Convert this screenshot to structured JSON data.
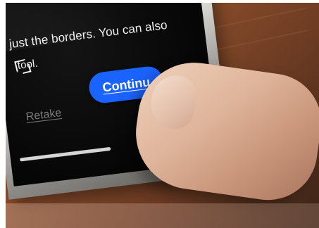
{
  "screen": {
    "instructions_line1": "just the borders. You can also",
    "instructions_line2": "tool.",
    "retake_label": "Retake",
    "continue_label": "Continu"
  },
  "icons": {
    "crop": "crop-icon"
  },
  "colors": {
    "continue_button": "#1b63ff",
    "screen_background": "#000000",
    "desk_background": "#7a4528",
    "finger_skin": "#dfb59b"
  }
}
